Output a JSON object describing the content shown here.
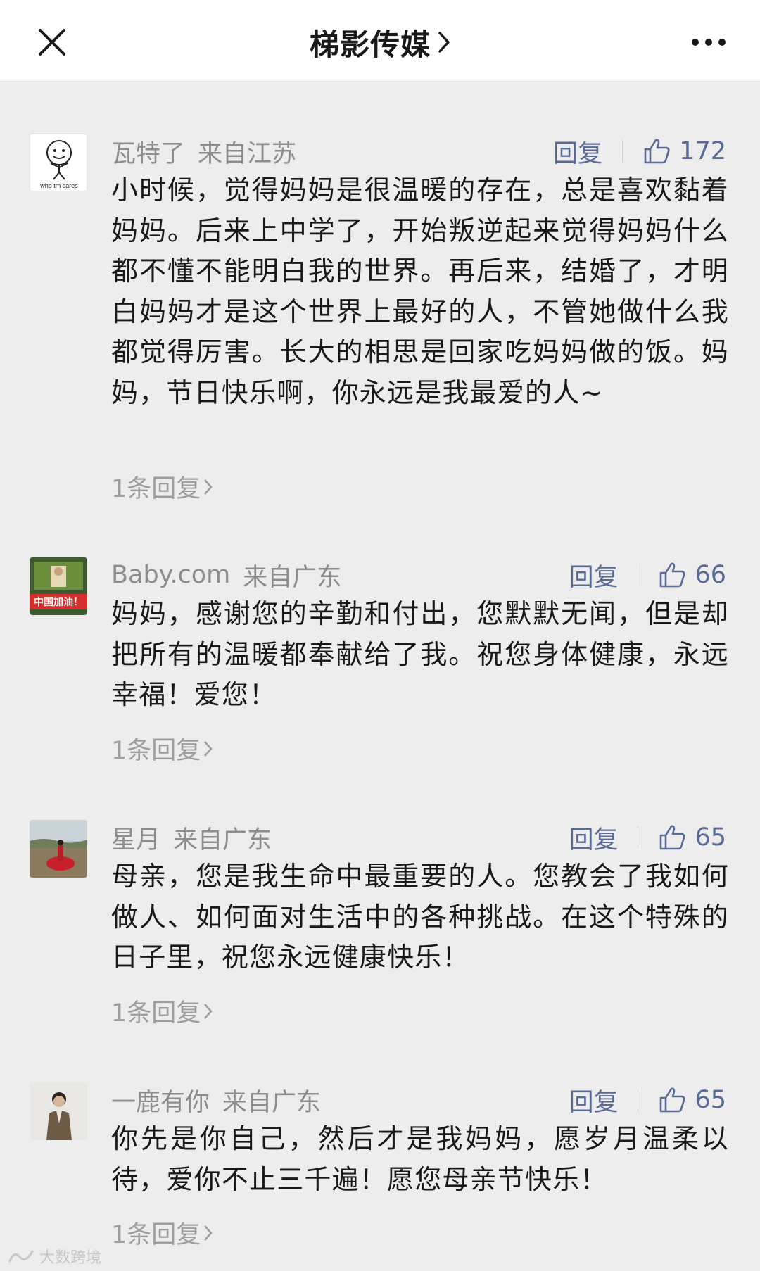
{
  "header": {
    "title": "梯影传媒",
    "close_icon": "close-icon",
    "more_icon": "more-icon"
  },
  "comments": [
    {
      "user": "瓦特了",
      "location": "来自江苏",
      "reply_label": "回复",
      "likes": "172",
      "avatar_text": "who tm cares",
      "text": "小时候，觉得妈妈是很温暖的存在，总是喜欢黏着妈妈。后来上中学了，开始叛逆起来觉得妈妈什么都不懂不能明白我的世界。再后来，结婚了，才明白妈妈才是这个世界上最好的人，不管她做什么我都觉得厉害。长大的相思是回家吃妈妈做的饭。妈妈，节日快乐啊，你永远是我最爱的人~",
      "sub_replies": "1条回复"
    },
    {
      "user": "Baby.com",
      "location": "来自广东",
      "reply_label": "回复",
      "likes": "66",
      "avatar_text": "中国加油！",
      "text": "妈妈，感谢您的辛勤和付出，您默默无闻，但是却把所有的温暖都奉献给了我。祝您身体健康，永远幸福！爱您！",
      "sub_replies": "1条回复"
    },
    {
      "user": "星月",
      "location": "来自广东",
      "reply_label": "回复",
      "likes": "65",
      "text": "母亲，您是我生命中最重要的人。您教会了我如何做人、如何面对生活中的各种挑战。在这个特殊的日子里，祝您永远健康快乐！",
      "sub_replies": "1条回复"
    },
    {
      "user": "一鹿有你",
      "location": "来自广东",
      "reply_label": "回复",
      "likes": "65",
      "text": "你先是你自己，然后才是我妈妈，愿岁月温柔以待，爱你不止三千遍！愿您母亲节快乐！",
      "sub_replies": "1条回复"
    }
  ],
  "watermark": "大数跨境",
  "colors": {
    "link": "#576b95",
    "meta": "#8d8d8d",
    "background": "#ededed"
  }
}
